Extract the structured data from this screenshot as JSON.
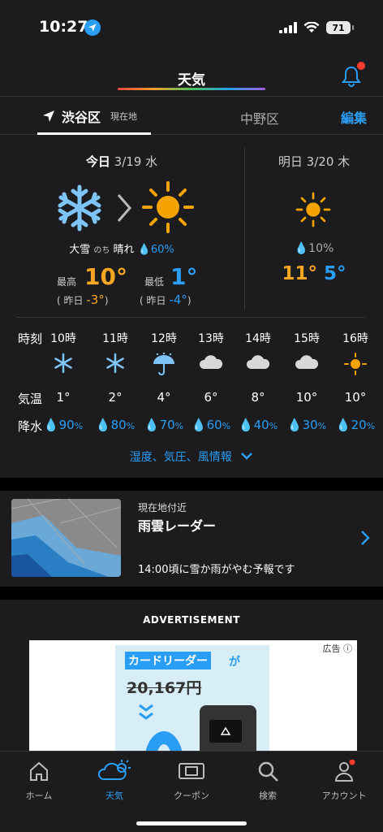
{
  "status": {
    "time": "10:27",
    "battery": "71"
  },
  "header": {
    "title": "天気"
  },
  "tabs": {
    "current": "渋谷区",
    "current_badge": "現在地",
    "other": "中野区",
    "edit": "編集"
  },
  "today": {
    "day": "今日",
    "date": "3/19 水",
    "condition_a": "大雪",
    "condition_sep": "のち",
    "condition_b": "晴れ",
    "precip": "60%",
    "high_label": "最高",
    "high": "10°",
    "low_label": "最低",
    "low": "1°",
    "yest_label": "昨日",
    "yest_high": "-3°",
    "yest_low": "-4°",
    "icons": [
      "snowflake-icon",
      "sun-icon"
    ]
  },
  "tomorrow": {
    "day": "明日",
    "date": "3/20 木",
    "precip": "10%",
    "high": "11°",
    "low": "5°",
    "icon": "sun-icon"
  },
  "hourly": {
    "labels": {
      "time": "時刻",
      "temp": "気温",
      "precip": "降水"
    },
    "hours": [
      {
        "h": "10時",
        "icon": "snow-icon",
        "t": "1°",
        "p": "90"
      },
      {
        "h": "11時",
        "icon": "snow-icon",
        "t": "2°",
        "p": "80"
      },
      {
        "h": "12時",
        "icon": "umbrella-icon",
        "t": "4°",
        "p": "70"
      },
      {
        "h": "13時",
        "icon": "cloud-icon",
        "t": "6°",
        "p": "60"
      },
      {
        "h": "14時",
        "icon": "cloud-icon",
        "t": "8°",
        "p": "40"
      },
      {
        "h": "15時",
        "icon": "cloud-icon",
        "t": "10°",
        "p": "30"
      },
      {
        "h": "16時",
        "icon": "sun-icon",
        "t": "10°",
        "p": "20"
      }
    ],
    "more": "湿度、気圧、風情報"
  },
  "radar": {
    "subtitle": "現在地付近",
    "title": "雨雲レーダー",
    "forecast": "14:00頃に雪か雨がやむ予報です"
  },
  "ad": {
    "heading": "ADVERTISEMENT",
    "label": "広告",
    "promo": "カードリーダー",
    "promo_suffix": "が",
    "price": "20,167円"
  },
  "tabbar": [
    {
      "label": "ホーム",
      "icon": "home-icon"
    },
    {
      "label": "天気",
      "icon": "weather-icon"
    },
    {
      "label": "クーポン",
      "icon": "coupon-icon"
    },
    {
      "label": "検索",
      "icon": "search-icon"
    },
    {
      "label": "アカウント",
      "icon": "account-icon"
    }
  ],
  "colors": {
    "accent": "#2a9df4",
    "warm": "#f5a623",
    "bg": "#1c1c1e"
  }
}
